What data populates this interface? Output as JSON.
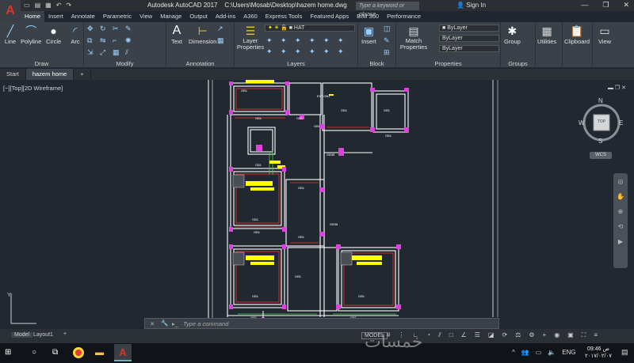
{
  "window": {
    "app_title": "Autodesk AutoCAD 2017",
    "file_path": "C:\\Users\\Mosab\\Desktop\\hazem home.dwg",
    "search_placeholder": "Type a keyword or phrase",
    "signin_label": "Sign In"
  },
  "ribbon_tabs": [
    "Home",
    "Insert",
    "Annotate",
    "Parametric",
    "View",
    "Manage",
    "Output",
    "Add-ins",
    "A360",
    "Express Tools",
    "Featured Apps",
    "BIM 360",
    "Performance"
  ],
  "ribbon": {
    "draw": {
      "title": "Draw",
      "line": "Line",
      "polyline": "Polyline",
      "circle": "Circle",
      "arc": "Arc"
    },
    "modify": {
      "title": "Modify"
    },
    "annotation": {
      "title": "Annotation",
      "text": "Text",
      "dimension": "Dimension"
    },
    "layers": {
      "title": "Layers",
      "layer_properties": "Layer Properties",
      "current_layer": "HAT"
    },
    "block": {
      "title": "Block",
      "insert": "Insert"
    },
    "properties": {
      "title": "Properties",
      "match": "Match Properties",
      "bylayer1": "ByLayer",
      "bylayer2": "ByLayer",
      "bylayer3": "ByLayer"
    },
    "groups": {
      "title": "Groups",
      "group": "Group"
    },
    "utilities": "Utilities",
    "clipboard": "Clipboard",
    "view": "View"
  },
  "doc_tabs": {
    "start": "Start",
    "current": "hazem home"
  },
  "viewport": {
    "label": "[−][Top][2D Wireframe]",
    "viewcube": {
      "n": "N",
      "s": "S",
      "e": "E",
      "w": "W",
      "top": "TOP",
      "wcs": "WCS"
    }
  },
  "command": {
    "placeholder": "Type a command"
  },
  "status": {
    "model_tab": "Model",
    "layout_tab": "Layout1",
    "model_btn": "MODEL"
  },
  "taskbar": {
    "lang": "ENG",
    "time": "09:46 ص",
    "date": "٢٠١٧/٠٢/٠٧"
  },
  "watermark": "خمسات",
  "colors": {
    "background": "#212830",
    "wall": "#ffffff",
    "hatch_yellow": "#ffff00",
    "column_magenta": "#e040e0",
    "dim_red": "#ff3030",
    "beam_green": "#4ad04a"
  }
}
